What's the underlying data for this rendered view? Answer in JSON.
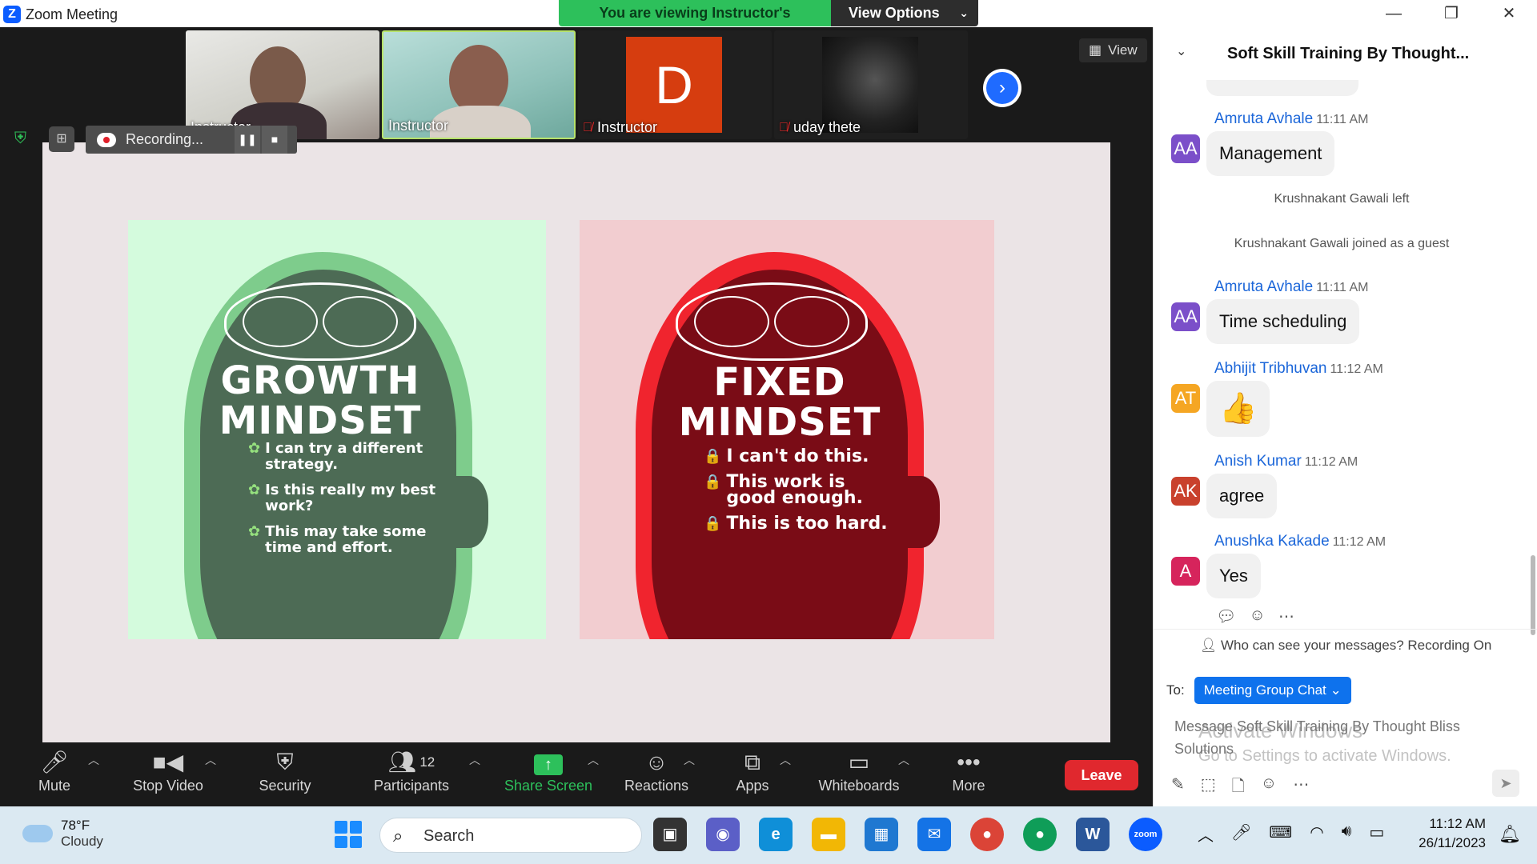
{
  "window": {
    "app_title": "Zoom Meeting",
    "viewing_banner": "You are viewing Instructor's screen",
    "view_options": "View Options",
    "minimize_symbol": "—",
    "maximize_symbol": "❐",
    "close_symbol": "✕"
  },
  "gallery": {
    "participants": [
      {
        "name": "Instructor",
        "muted": false
      },
      {
        "name": "Instructor",
        "muted": false
      },
      {
        "name": "Instructor",
        "muted": true,
        "avatar_letter": "D"
      },
      {
        "name": "uday thete",
        "muted": true
      }
    ],
    "view_label": "View"
  },
  "recording": {
    "label": "Recording...",
    "pause_symbol": "❚❚",
    "stop_symbol": "■"
  },
  "shared_screen": {
    "growth": {
      "title_line1": "GROWTH",
      "title_line2": "MINDSET",
      "items": [
        "I can try a different strategy.",
        "Is this really my best work?",
        "This may take some time and effort."
      ]
    },
    "fixed": {
      "title_line1": "FIXED",
      "title_line2": "MINDSET",
      "items": [
        "I can't do this.",
        "This work is good enough.",
        "This is too hard."
      ]
    },
    "colors": {
      "growth_bg": "#d4fbdd",
      "growth_head": "#4d6b55",
      "fixed_bg": "#f2cdd0",
      "fixed_head": "#7a0c16"
    }
  },
  "toolbar": {
    "mute": "Mute",
    "stop_video": "Stop Video",
    "security": "Security",
    "participants": "Participants",
    "participant_count": "12",
    "share_screen": "Share Screen",
    "reactions": "Reactions",
    "apps": "Apps",
    "whiteboards": "Whiteboards",
    "more": "More",
    "leave": "Leave"
  },
  "chat": {
    "title": "Soft Skill Training By Thought...",
    "messages": [
      {
        "initials": "AA",
        "sender": "Amruta Avhale",
        "time": "11:11 AM",
        "text": "Management",
        "color": "#7b4fc9"
      },
      {
        "initials": "AA",
        "sender": "Amruta Avhale",
        "time": "11:11 AM",
        "text": "Time scheduling",
        "color": "#7b4fc9"
      },
      {
        "initials": "AT",
        "sender": "Abhijit Tribhuvan",
        "time": "11:12 AM",
        "text": "👍",
        "color": "#f5a623"
      },
      {
        "initials": "AK",
        "sender": "Anish Kumar",
        "time": "11:12 AM",
        "text": "agree",
        "color": "#c9412d"
      },
      {
        "initials": "A",
        "sender": "Anushka Kakade",
        "time": "11:12 AM",
        "text": "Yes",
        "color": "#d6245c"
      }
    ],
    "system": [
      "Krushnakant Gawali left",
      "Krushnakant Gawali joined as a guest"
    ],
    "privacy_notice": "Who can see your messages? Recording On",
    "to_label": "To:",
    "to_value": "Meeting Group Chat",
    "input_placeholder": "Message Soft Skill Training By Thought Bliss Solutions",
    "watermark_line1": "Activate Windows",
    "watermark_line2": "Go to Settings to activate Windows."
  },
  "taskbar": {
    "weather_temp": "78°F",
    "weather_desc": "Cloudy",
    "search_label": "Search",
    "time": "11:12 AM",
    "date": "26/11/2023"
  }
}
